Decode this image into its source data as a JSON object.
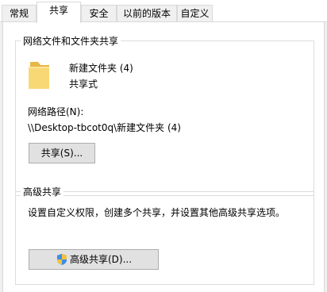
{
  "tabs": [
    {
      "label": "常规",
      "active": false
    },
    {
      "label": "共享",
      "active": true
    },
    {
      "label": "安全",
      "active": false
    },
    {
      "label": "以前的版本",
      "active": false
    },
    {
      "label": "自定义",
      "active": false
    }
  ],
  "network_share": {
    "group_title": "网络文件和文件夹共享",
    "folder_name": "新建文件夹 (4)",
    "share_state": "共享式",
    "network_path_label": "网络路径(N):",
    "network_path_value": "\\\\Desktop-tbcot0q\\新建文件夹 (4)",
    "share_button_label": "共享(S)...",
    "folder_icon": "folder-icon"
  },
  "advanced_share": {
    "group_title": "高级共享",
    "description": "设置自定义权限，创建多个共享，并设置其他高级共享选项。",
    "button_label": "高级共享(D)...",
    "button_icon": "uac-shield-icon"
  },
  "colors": {
    "folder_yellow": "#f8d775",
    "folder_dark": "#e8b844",
    "button_bg": "#e1e1e1",
    "button_border": "#adadad",
    "panel_bg": "#f0f0f0"
  }
}
